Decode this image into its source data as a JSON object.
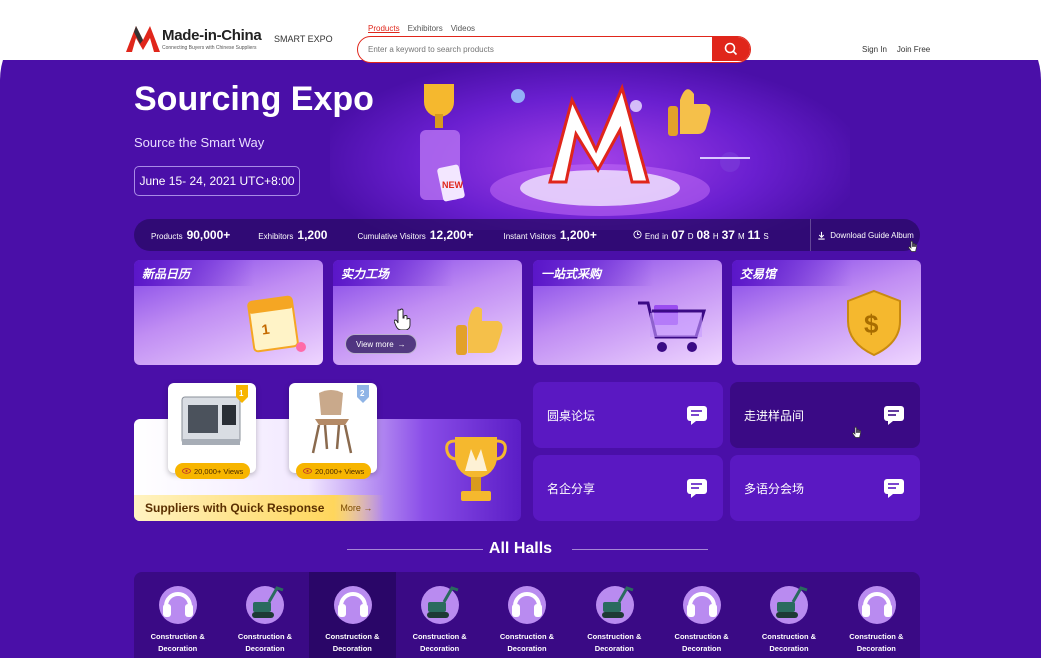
{
  "header": {
    "logo_text": "Made-in-China",
    "logo_tagline": "Connecting Buyers with Chinese Suppliers",
    "section_name": "SMART EXPO",
    "search_tabs": [
      "Products",
      "Exhibitors",
      "Videos"
    ],
    "search_placeholder": "Enter a keyword to search products",
    "sign_in": "Sign In",
    "join_free": "Join Free"
  },
  "hero": {
    "title": "Sourcing Expo",
    "subtitle": "Source the Smart Way",
    "date": "June 15- 24, 2021 UTC+8:00",
    "badge_text": "NEW"
  },
  "stats": {
    "products_label": "Products",
    "products_value": "90,000+",
    "exhibitors_label": "Exhibitors",
    "exhibitors_value": "1,200",
    "cumulative_label": "Cumulative Visitors",
    "cumulative_value": "12,200+",
    "instant_label": "Instant Visitors",
    "instant_value": "1,200+",
    "end_label": "End",
    "in_label": "in",
    "days": "07",
    "days_unit": "D",
    "hours": "08",
    "hours_unit": "H",
    "minutes": "37",
    "minutes_unit": "M",
    "seconds": "11",
    "seconds_unit": "S",
    "download_label": "Download Guide Album"
  },
  "feature_cards": [
    {
      "title": "新品日历"
    },
    {
      "title": "实力工场",
      "button": "View more"
    },
    {
      "title": "一站式采购"
    },
    {
      "title": "交易馆"
    }
  ],
  "suppliers": {
    "label": "Suppliers with Quick Response",
    "more": "More",
    "products": [
      {
        "views": "20,000+ Views",
        "rank": "1"
      },
      {
        "views": "20,000+ Views",
        "rank": "2"
      }
    ]
  },
  "forums": [
    "圆桌论坛",
    "走进样品间",
    "名企分享",
    "多语分会场"
  ],
  "halls": {
    "title": "All Halls",
    "items": [
      {
        "line1": "Construction &",
        "line2": "Decoration",
        "icon": "headphones-icon"
      },
      {
        "line1": "Construction &",
        "line2": "Decoration",
        "icon": "excavator-icon"
      },
      {
        "line1": "Construction &",
        "line2": "Decoration",
        "icon": "headphones-icon"
      },
      {
        "line1": "Construction &",
        "line2": "Decoration",
        "icon": "excavator-icon"
      },
      {
        "line1": "Construction &",
        "line2": "Decoration",
        "icon": "headphones-icon"
      },
      {
        "line1": "Construction &",
        "line2": "Decoration",
        "icon": "excavator-icon"
      },
      {
        "line1": "Construction &",
        "line2": "Decoration",
        "icon": "headphones-icon"
      },
      {
        "line1": "Construction &",
        "line2": "Decoration",
        "icon": "excavator-icon"
      },
      {
        "line1": "Construction &",
        "line2": "Decoration",
        "icon": "headphones-icon"
      }
    ]
  },
  "colors": {
    "brand_red": "#e0261b",
    "background_purple": "#4a0fa8",
    "panel_purple": "#3a0a85",
    "views_gold": "#f7b500"
  }
}
